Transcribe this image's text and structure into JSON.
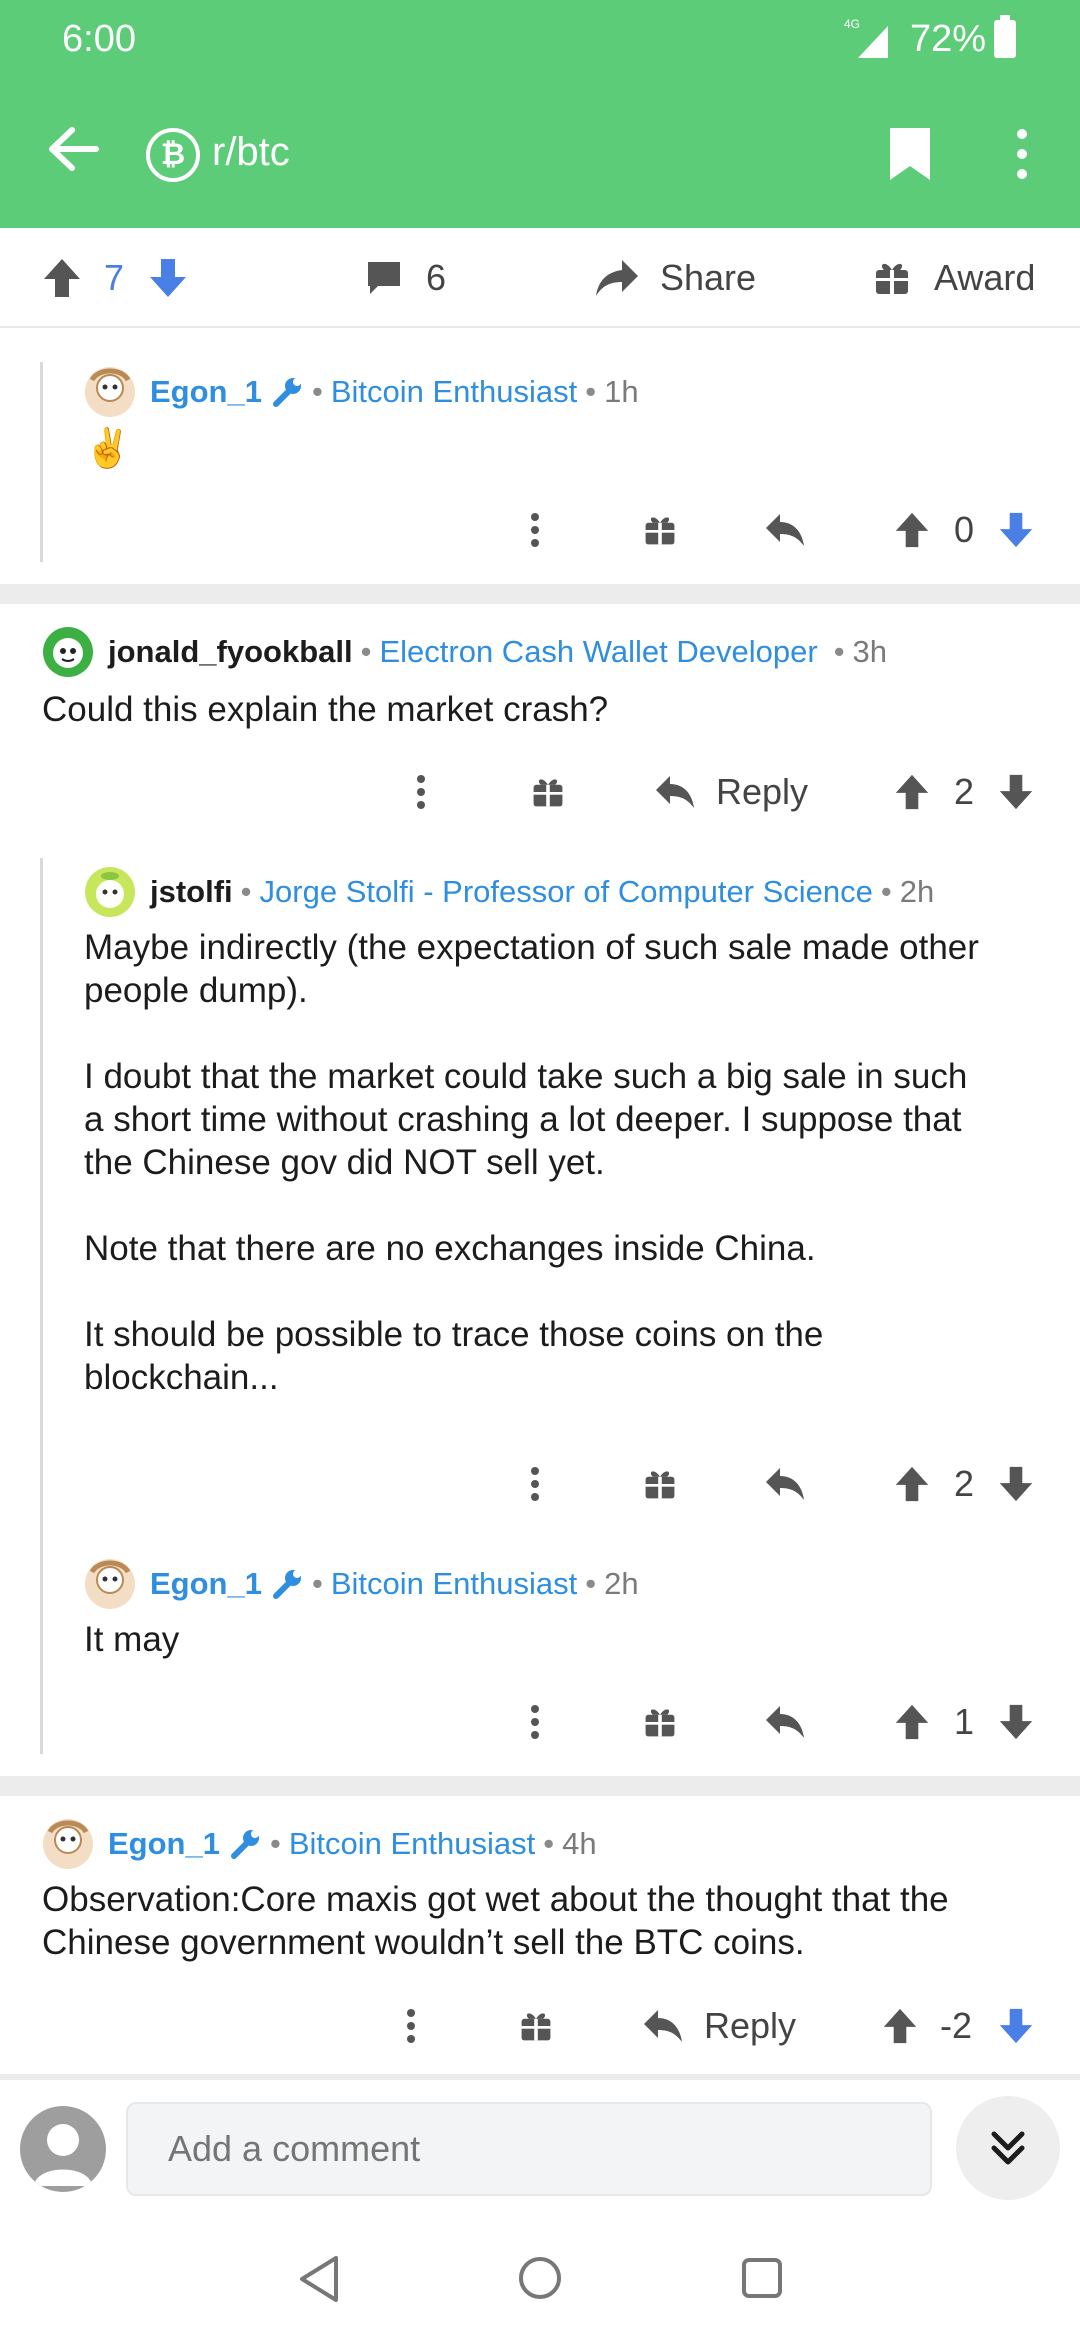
{
  "status_bar": {
    "time": "6:00",
    "network": "4G",
    "battery_pct": "72%"
  },
  "app_bar": {
    "subreddit": "r/btc",
    "sub_icon_glyph": "₿"
  },
  "post_bar": {
    "score": "7",
    "comments": "6",
    "share_label": "Share",
    "award_label": "Award"
  },
  "comments": [
    {
      "author": "Egon_1",
      "flair": "Bitcoin Enthusiast",
      "age": "1h",
      "body": "✌️",
      "score": "0"
    },
    {
      "author": "jonald_fyookball",
      "flair": "Electron Cash Wallet Developer",
      "age": "3h",
      "body": "Could this explain the market crash?",
      "reply_label": "Reply",
      "score": "2"
    },
    {
      "author": "jstolfi",
      "flair": "Jorge Stolfi - Professor of Computer Science",
      "age": "2h",
      "body": "Maybe indirectly (the expectation of such sale made other\npeople dump).\n\nI doubt that the market could take such a big sale in such\na short time without crashing a lot deeper.   I suppose that\nthe Chinese gov did NOT sell yet.\n\nNote that there are no exchanges inside China.\n\nIt should be possible to trace those coins on the\nblockchain...",
      "score": "2"
    },
    {
      "author": "Egon_1",
      "flair": "Bitcoin Enthusiast",
      "age": "2h",
      "body": "It may",
      "score": "1"
    },
    {
      "author": "Egon_1",
      "flair": "Bitcoin Enthusiast",
      "age": "4h",
      "body": "Observation:Core maxis got wet about the thought that the\nChinese government wouldn’t sell the BTC coins.",
      "reply_label": "Reply",
      "score": "-2"
    }
  ],
  "composer": {
    "placeholder": "Add a comment"
  },
  "colors": {
    "brand_green": "#5dcc79",
    "link_blue": "#2f8ee0",
    "vote_blue": "#4a7fe5"
  }
}
